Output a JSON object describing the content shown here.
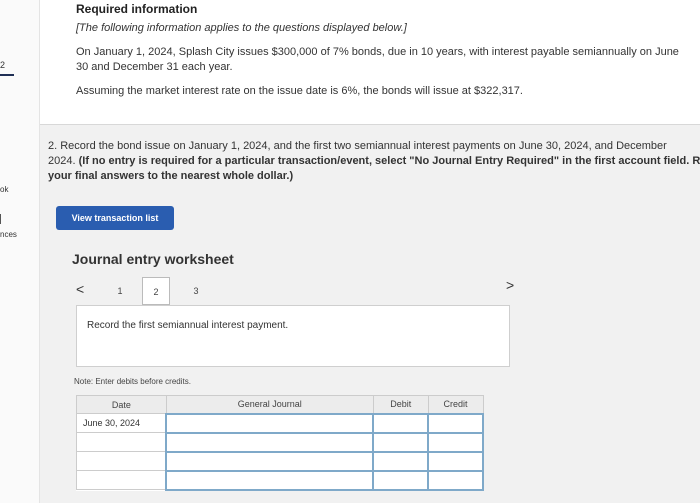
{
  "left_strip": {
    "num": "2",
    "ok": "ok",
    "nces": "nces"
  },
  "header": {
    "title": "Required information",
    "italic_note": "[The following information applies to the questions displayed below.]",
    "para1": "On January 1, 2024, Splash City issues $300,000 of 7% bonds, due in 10 years, with interest payable semiannually on June 30 and December 31 each year.",
    "para2": "Assuming the market interest rate on the issue date is 6%, the bonds will issue at $322,317."
  },
  "question": {
    "line1": "2. Record the bond issue on January 1, 2024, and the first two semiannual interest payments on June 30, 2024, and December",
    "line2_normal": "2024. ",
    "line2_bold": "(If no entry is required for a particular transaction/event, select \"No Journal Entry Required\" in the first account field. R",
    "line3_bold": "your final answers to the nearest whole dollar.)"
  },
  "toolbar": {
    "view_transaction_list": "View transaction list"
  },
  "worksheet": {
    "title": "Journal entry worksheet",
    "prev_icon": "<",
    "next_icon": ">",
    "tabs": [
      "1",
      "2",
      "3"
    ],
    "active_tab": "2",
    "instruction": "Record the first semiannual interest payment.",
    "note": "Note: Enter debits before credits."
  },
  "table": {
    "headers": [
      "Date",
      "General Journal",
      "Debit",
      "Credit"
    ],
    "rows": [
      {
        "date": "June 30, 2024",
        "account": "",
        "debit": "",
        "credit": ""
      },
      {
        "date": "",
        "account": "",
        "debit": "",
        "credit": ""
      },
      {
        "date": "",
        "account": "",
        "debit": "",
        "credit": ""
      },
      {
        "date": "",
        "account": "",
        "debit": "",
        "credit": ""
      }
    ]
  }
}
